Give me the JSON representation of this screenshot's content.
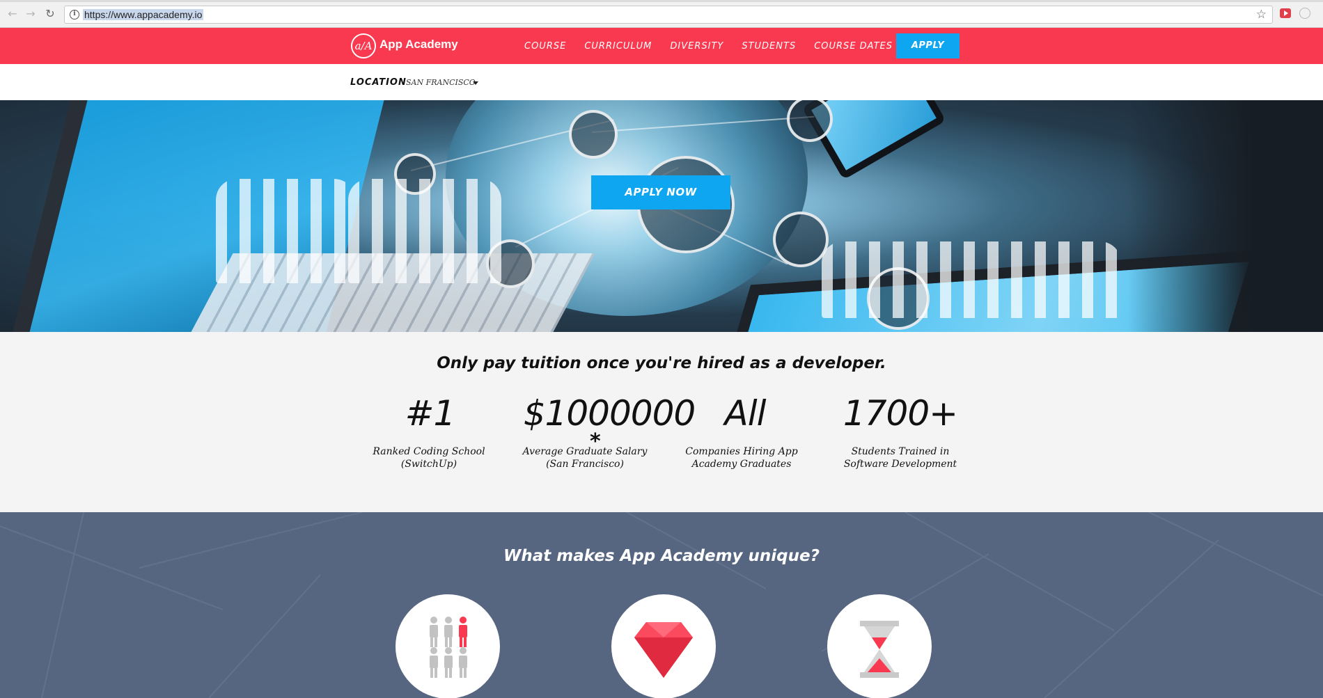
{
  "browser": {
    "url": "https://www.appacademy.io",
    "icons": [
      "back-icon",
      "forward-icon",
      "reload-icon",
      "info-icon",
      "star-icon",
      "extension-icon"
    ]
  },
  "header": {
    "logo_mark": "a/A",
    "brand": "App Academy",
    "nav": [
      "COURSE",
      "CURRICULUM",
      "DIVERSITY",
      "STUDENTS",
      "COURSE DATES"
    ],
    "apply_label": "APPLY",
    "colors": {
      "brand": "#f9394f",
      "accent": "#0fa6f1"
    }
  },
  "location": {
    "label": "LOCATION",
    "value": "SAN FRANCISCO"
  },
  "hero": {
    "cta_label": "APPLY NOW"
  },
  "stats": {
    "headline": "Only pay tuition once you're hired as a developer.",
    "items": [
      {
        "value": "#1",
        "caption_1": "Ranked Coding School",
        "caption_2": "(SwitchUp)"
      },
      {
        "value": "$1000000",
        "caption_1": "Average Graduate Salary",
        "caption_2": "(San Francisco)"
      },
      {
        "value": "All",
        "caption_1": "Companies Hiring App",
        "caption_2": "Academy Graduates"
      },
      {
        "value": "1700+",
        "caption_1": "Students Trained in",
        "caption_2": "Software Development"
      }
    ],
    "asterisk": "*"
  },
  "unique": {
    "title": "What makes App Academy unique?",
    "features": [
      {
        "icon": "people-group-icon"
      },
      {
        "icon": "ruby-gem-icon"
      },
      {
        "icon": "hourglass-icon"
      }
    ]
  }
}
